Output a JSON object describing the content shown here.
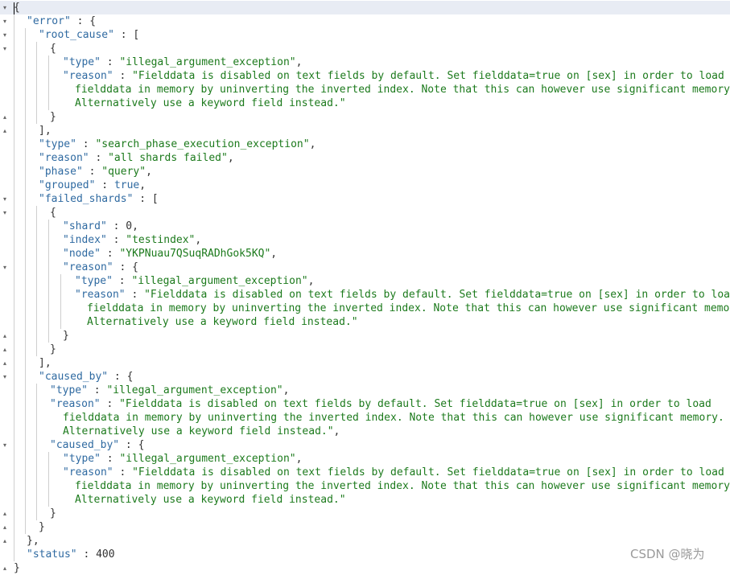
{
  "editor": {
    "lines": [
      [
        {
          "t": "p",
          "v": "{"
        }
      ],
      [
        {
          "t": "k",
          "v": "\"error\""
        },
        {
          "t": "p",
          "v": " : {"
        }
      ],
      [
        {
          "t": "k",
          "v": "\"root_cause\""
        },
        {
          "t": "p",
          "v": " : ["
        }
      ],
      [
        {
          "t": "p",
          "v": "{"
        }
      ],
      [
        {
          "t": "k",
          "v": "\"type\""
        },
        {
          "t": "p",
          "v": " : "
        },
        {
          "t": "s",
          "v": "\"illegal_argument_exception\""
        },
        {
          "t": "p",
          "v": ","
        }
      ],
      [
        {
          "t": "k",
          "v": "\"reason\""
        },
        {
          "t": "p",
          "v": " : "
        },
        {
          "t": "s",
          "v": "\"Fielddata is disabled on text fields by default. Set fielddata=true on [sex] in order to load"
        }
      ],
      [
        {
          "t": "s",
          "v": "fielddata in memory by uninverting the inverted index. Note that this can however use significant memory."
        }
      ],
      [
        {
          "t": "s",
          "v": "Alternatively use a keyword field instead.\""
        }
      ],
      [
        {
          "t": "p",
          "v": "}"
        }
      ],
      [
        {
          "t": "p",
          "v": "],"
        }
      ],
      [
        {
          "t": "k",
          "v": "\"type\""
        },
        {
          "t": "p",
          "v": " : "
        },
        {
          "t": "s",
          "v": "\"search_phase_execution_exception\""
        },
        {
          "t": "p",
          "v": ","
        }
      ],
      [
        {
          "t": "k",
          "v": "\"reason\""
        },
        {
          "t": "p",
          "v": " : "
        },
        {
          "t": "s",
          "v": "\"all shards failed\""
        },
        {
          "t": "p",
          "v": ","
        }
      ],
      [
        {
          "t": "k",
          "v": "\"phase\""
        },
        {
          "t": "p",
          "v": " : "
        },
        {
          "t": "s",
          "v": "\"query\""
        },
        {
          "t": "p",
          "v": ","
        }
      ],
      [
        {
          "t": "k",
          "v": "\"grouped\""
        },
        {
          "t": "p",
          "v": " : "
        },
        {
          "t": "b",
          "v": "true"
        },
        {
          "t": "p",
          "v": ","
        }
      ],
      [
        {
          "t": "k",
          "v": "\"failed_shards\""
        },
        {
          "t": "p",
          "v": " : ["
        }
      ],
      [
        {
          "t": "p",
          "v": "{"
        }
      ],
      [
        {
          "t": "k",
          "v": "\"shard\""
        },
        {
          "t": "p",
          "v": " : "
        },
        {
          "t": "n",
          "v": "0"
        },
        {
          "t": "p",
          "v": ","
        }
      ],
      [
        {
          "t": "k",
          "v": "\"index\""
        },
        {
          "t": "p",
          "v": " : "
        },
        {
          "t": "s",
          "v": "\"testindex\""
        },
        {
          "t": "p",
          "v": ","
        }
      ],
      [
        {
          "t": "k",
          "v": "\"node\""
        },
        {
          "t": "p",
          "v": " : "
        },
        {
          "t": "s",
          "v": "\"YKPNuau7QSuqRADhGok5KQ\""
        },
        {
          "t": "p",
          "v": ","
        }
      ],
      [
        {
          "t": "k",
          "v": "\"reason\""
        },
        {
          "t": "p",
          "v": " : {"
        }
      ],
      [
        {
          "t": "k",
          "v": "\"type\""
        },
        {
          "t": "p",
          "v": " : "
        },
        {
          "t": "s",
          "v": "\"illegal_argument_exception\""
        },
        {
          "t": "p",
          "v": ","
        }
      ],
      [
        {
          "t": "k",
          "v": "\"reason\""
        },
        {
          "t": "p",
          "v": " : "
        },
        {
          "t": "s",
          "v": "\"Fielddata is disabled on text fields by default. Set fielddata=true on [sex] in order to load"
        }
      ],
      [
        {
          "t": "s",
          "v": "fielddata in memory by uninverting the inverted index. Note that this can however use significant memory."
        }
      ],
      [
        {
          "t": "s",
          "v": "Alternatively use a keyword field instead.\""
        }
      ],
      [
        {
          "t": "p",
          "v": "}"
        }
      ],
      [
        {
          "t": "p",
          "v": "}"
        }
      ],
      [
        {
          "t": "p",
          "v": "],"
        }
      ],
      [
        {
          "t": "k",
          "v": "\"caused_by\""
        },
        {
          "t": "p",
          "v": " : {"
        }
      ],
      [
        {
          "t": "k",
          "v": "\"type\""
        },
        {
          "t": "p",
          "v": " : "
        },
        {
          "t": "s",
          "v": "\"illegal_argument_exception\""
        },
        {
          "t": "p",
          "v": ","
        }
      ],
      [
        {
          "t": "k",
          "v": "\"reason\""
        },
        {
          "t": "p",
          "v": " : "
        },
        {
          "t": "s",
          "v": "\"Fielddata is disabled on text fields by default. Set fielddata=true on [sex] in order to load"
        }
      ],
      [
        {
          "t": "s",
          "v": "fielddata in memory by uninverting the inverted index. Note that this can however use significant memory."
        }
      ],
      [
        {
          "t": "s",
          "v": "Alternatively use a keyword field instead.\""
        },
        {
          "t": "p",
          "v": ","
        }
      ],
      [
        {
          "t": "k",
          "v": "\"caused_by\""
        },
        {
          "t": "p",
          "v": " : {"
        }
      ],
      [
        {
          "t": "k",
          "v": "\"type\""
        },
        {
          "t": "p",
          "v": " : "
        },
        {
          "t": "s",
          "v": "\"illegal_argument_exception\""
        },
        {
          "t": "p",
          "v": ","
        }
      ],
      [
        {
          "t": "k",
          "v": "\"reason\""
        },
        {
          "t": "p",
          "v": " : "
        },
        {
          "t": "s",
          "v": "\"Fielddata is disabled on text fields by default. Set fielddata=true on [sex] in order to load"
        }
      ],
      [
        {
          "t": "s",
          "v": "fielddata in memory by uninverting the inverted index. Note that this can however use significant memory."
        }
      ],
      [
        {
          "t": "s",
          "v": "Alternatively use a keyword field instead.\""
        }
      ],
      [
        {
          "t": "p",
          "v": "}"
        }
      ],
      [
        {
          "t": "p",
          "v": "}"
        }
      ],
      [
        {
          "t": "p",
          "v": "},"
        }
      ],
      [
        {
          "t": "k",
          "v": "\"status\""
        },
        {
          "t": "p",
          "v": " : "
        },
        {
          "t": "n",
          "v": "400"
        }
      ],
      [
        {
          "t": "p",
          "v": "}"
        }
      ]
    ]
  },
  "colors": {
    "key": "#2f6aa1",
    "string": "#1c7a1c",
    "punctuation": "#333333",
    "active_line": "#e8ecf4"
  },
  "watermark": "CSDN @晓为"
}
